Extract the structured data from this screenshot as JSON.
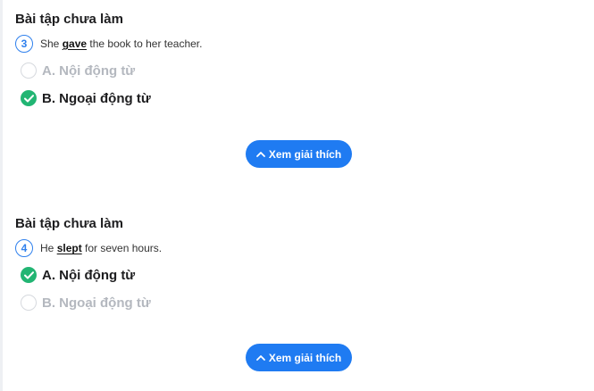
{
  "questions": [
    {
      "heading": "Bài tập chưa làm",
      "number": "3",
      "sentence_before": "She ",
      "keyword": "gave",
      "sentence_after": " the book to her teacher.",
      "options": [
        {
          "label": "A. Nội động từ",
          "selected": false
        },
        {
          "label": "B. Ngoại động từ",
          "selected": true
        }
      ],
      "explain_label": "Xem giải thích"
    },
    {
      "heading": "Bài tập chưa làm",
      "number": "4",
      "sentence_before": "He ",
      "keyword": "slept",
      "sentence_after": " for seven hours.",
      "options": [
        {
          "label": "A. Nội động từ",
          "selected": true
        },
        {
          "label": "B. Ngoại động từ",
          "selected": false
        }
      ],
      "explain_label": "Xem giải thích"
    }
  ],
  "colors": {
    "accent": "#1f7bf2",
    "correct": "#22b573",
    "muted_text": "#b4b8bf"
  },
  "icons": {
    "check": "check-icon",
    "chevron": "chevron-up-icon"
  }
}
